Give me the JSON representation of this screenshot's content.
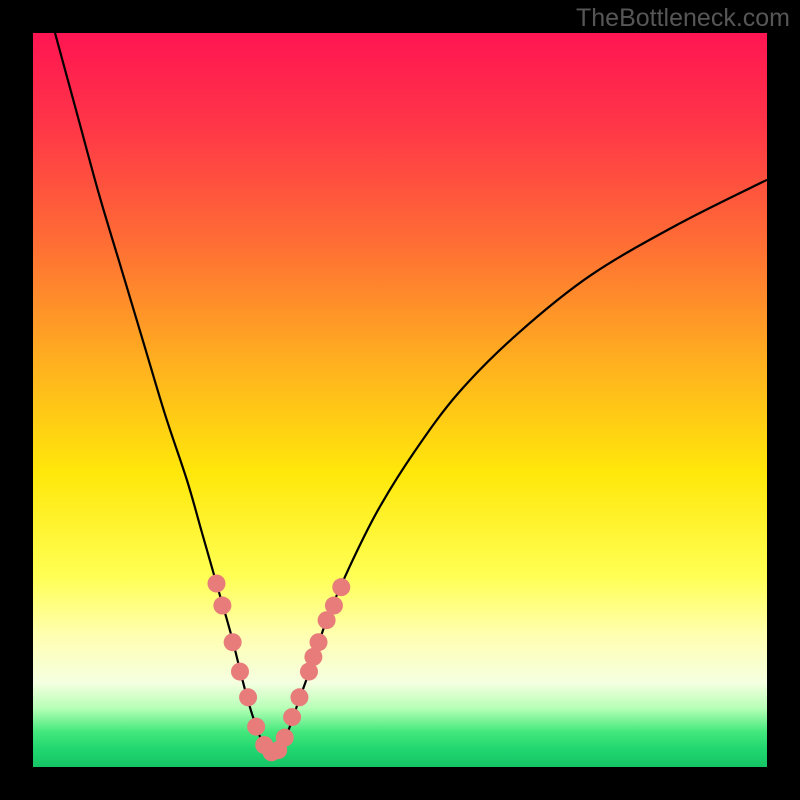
{
  "watermark": "TheBottleneck.com",
  "colors": {
    "frame": "#000000",
    "curve": "#000000",
    "markers": "#e77c7b",
    "gradient_stops": [
      {
        "offset": 0.0,
        "color": "#ff1552"
      },
      {
        "offset": 0.12,
        "color": "#ff3448"
      },
      {
        "offset": 0.28,
        "color": "#ff6b35"
      },
      {
        "offset": 0.45,
        "color": "#ffb01f"
      },
      {
        "offset": 0.6,
        "color": "#ffe80a"
      },
      {
        "offset": 0.74,
        "color": "#ffff54"
      },
      {
        "offset": 0.82,
        "color": "#ffffb0"
      },
      {
        "offset": 0.885,
        "color": "#f5ffe0"
      },
      {
        "offset": 0.92,
        "color": "#b6ffb6"
      },
      {
        "offset": 0.952,
        "color": "#44e87c"
      },
      {
        "offset": 0.975,
        "color": "#22d770"
      },
      {
        "offset": 1.0,
        "color": "#14c465"
      }
    ]
  },
  "chart_data": {
    "type": "line",
    "title": "",
    "xlabel": "",
    "ylabel": "",
    "xlim": [
      0,
      100
    ],
    "ylim": [
      0,
      100
    ],
    "series": [
      {
        "name": "bottleneck-curve",
        "x": [
          3,
          6,
          9,
          12,
          15,
          18,
          21,
          23,
          25,
          27,
          28.5,
          29.6,
          30.6,
          31.4,
          32.2,
          33.0,
          33.8,
          34.8,
          36.2,
          38,
          40,
          43,
          47,
          52,
          58,
          66,
          76,
          88,
          100
        ],
        "y": [
          100,
          89,
          78,
          68,
          58,
          48,
          39,
          32,
          25,
          18,
          12,
          8,
          5,
          3,
          2,
          2,
          3,
          5,
          9,
          14,
          20,
          27,
          35,
          43,
          51,
          59,
          67,
          74,
          80
        ]
      }
    ],
    "markers": {
      "name": "highlight-points",
      "x": [
        25.0,
        25.8,
        27.2,
        28.2,
        29.3,
        30.4,
        31.5,
        32.5,
        33.4,
        34.3,
        35.3,
        36.3,
        37.6,
        38.2,
        38.9,
        40.0,
        41.0,
        42.0
      ],
      "y": [
        25.0,
        22.0,
        17.0,
        13.0,
        9.5,
        5.5,
        3.0,
        2.0,
        2.3,
        4.0,
        6.8,
        9.5,
        13.0,
        15.0,
        17.0,
        20.0,
        22.0,
        24.5
      ]
    }
  }
}
